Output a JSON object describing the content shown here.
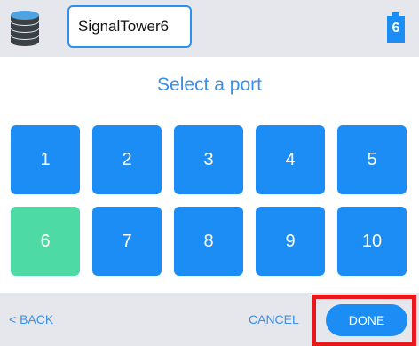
{
  "header": {
    "device_icon": "stacked-disc-tower-icon",
    "device_name": "SignalTower6",
    "port_indicator": {
      "icon": "port-icon",
      "value": "6"
    }
  },
  "main": {
    "title": "Select a port",
    "ports": [
      {
        "label": "1",
        "selected": false
      },
      {
        "label": "2",
        "selected": false
      },
      {
        "label": "3",
        "selected": false
      },
      {
        "label": "4",
        "selected": false
      },
      {
        "label": "5",
        "selected": false
      },
      {
        "label": "6",
        "selected": true
      },
      {
        "label": "7",
        "selected": false
      },
      {
        "label": "8",
        "selected": false
      },
      {
        "label": "9",
        "selected": false
      },
      {
        "label": "10",
        "selected": false
      }
    ]
  },
  "footer": {
    "back_label": "< BACK",
    "cancel_label": "CANCEL",
    "done_label": "DONE"
  },
  "colors": {
    "accent": "#1c8df5",
    "selected": "#4ddaa4",
    "bar": "#e6e7ec",
    "highlight": "#e8181c"
  }
}
